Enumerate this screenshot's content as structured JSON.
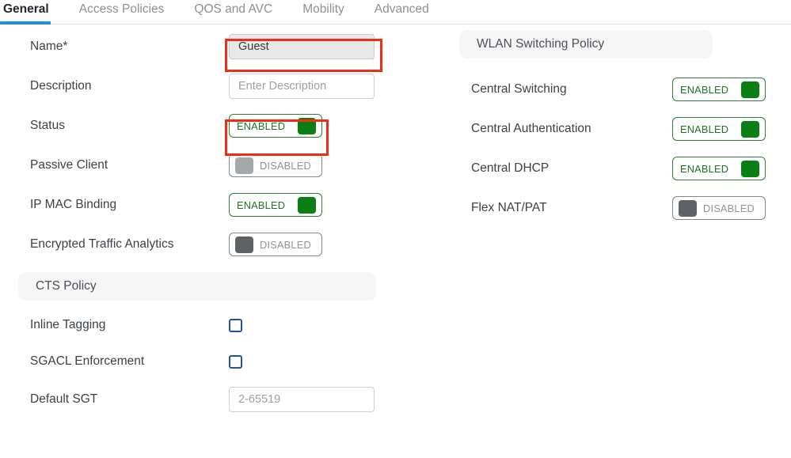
{
  "tabs": [
    {
      "label": "General",
      "active": true
    },
    {
      "label": "Access Policies",
      "active": false
    },
    {
      "label": "QOS and AVC",
      "active": false
    },
    {
      "label": "Mobility",
      "active": false
    },
    {
      "label": "Advanced",
      "active": false
    }
  ],
  "left_column": {
    "fields": [
      {
        "label": "Name*",
        "type": "text",
        "value": "Guest",
        "readonly": true,
        "highlighted": true
      },
      {
        "label": "Description",
        "type": "text",
        "value": "",
        "placeholder": "Enter Description",
        "readonly": false,
        "highlighted": false
      },
      {
        "label": "Status",
        "type": "toggle",
        "state": "ENABLED",
        "on": true,
        "highlighted": true
      },
      {
        "label": "Passive Client",
        "type": "toggle",
        "state": "DISABLED",
        "on": false,
        "highlighted": false
      },
      {
        "label": "IP MAC Binding",
        "type": "toggle",
        "state": "ENABLED",
        "on": true,
        "highlighted": false
      },
      {
        "label": "Encrypted Traffic Analytics",
        "type": "toggle",
        "state": "DISABLED",
        "on": false,
        "highlighted": false
      }
    ],
    "cts_policy": {
      "header": "CTS Policy",
      "fields": [
        {
          "label": "Inline Tagging",
          "type": "checkbox",
          "checked": false
        },
        {
          "label": "SGACL Enforcement",
          "type": "checkbox",
          "checked": false
        },
        {
          "label": "Default SGT",
          "type": "text",
          "value": "",
          "placeholder": "2-65519"
        }
      ]
    }
  },
  "right_column": {
    "wlan_switching_policy": {
      "header": "WLAN Switching Policy",
      "fields": [
        {
          "label": "Central Switching",
          "type": "toggle",
          "state": "ENABLED",
          "on": true
        },
        {
          "label": "Central Authentication",
          "type": "toggle",
          "state": "ENABLED",
          "on": true
        },
        {
          "label": "Central DHCP",
          "type": "toggle",
          "state": "ENABLED",
          "on": true
        },
        {
          "label": "Flex NAT/PAT",
          "type": "toggle",
          "state": "DISABLED",
          "on": false
        }
      ]
    }
  },
  "colors": {
    "accent_tab": "#1f8fd8",
    "toggle_on": "#0a8014",
    "toggle_on_border": "#2f7d32",
    "toggle_off": "#a6a9ab",
    "toggle_off_dark": "#5e6266",
    "checkbox_border": "#23529f",
    "annotation": "#f22b16",
    "section_header_bg": "#f6f6f7"
  }
}
